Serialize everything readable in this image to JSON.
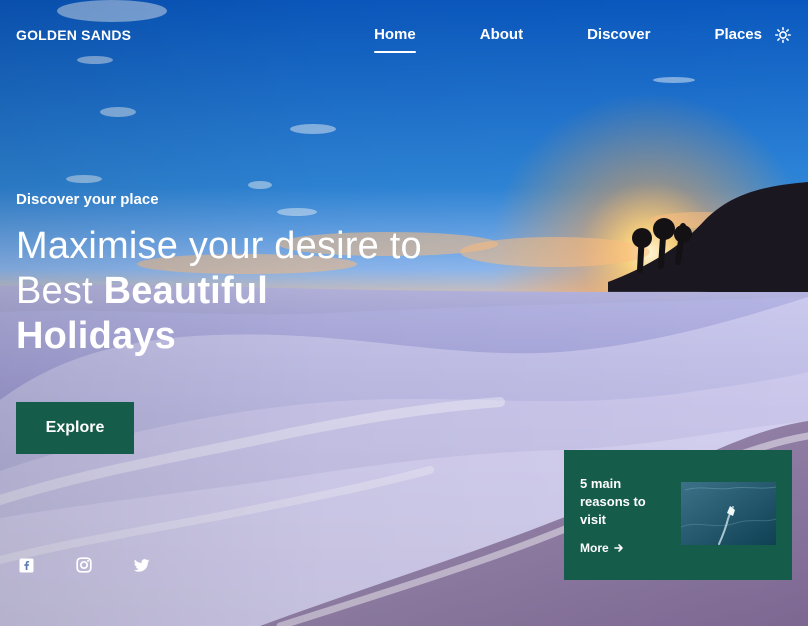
{
  "header": {
    "brand": "GOLDEN SANDS",
    "nav": [
      {
        "label": "Home",
        "active": true
      },
      {
        "label": "About",
        "active": false
      },
      {
        "label": "Discover",
        "active": false
      },
      {
        "label": "Places",
        "active": false
      }
    ],
    "theme_toggle_icon": "sun-icon"
  },
  "hero": {
    "eyebrow": "Discover your place",
    "headline_line1": "Maximise your desire to",
    "headline_line2_regular": "Best",
    "headline_line2_bold": "Beautiful",
    "headline_line3_bold": "Holidays",
    "button_label": "Explore",
    "button_color": "#165c4b",
    "background_icon": "beach-sunset-image"
  },
  "social": [
    {
      "name": "facebook",
      "icon": "facebook-icon"
    },
    {
      "name": "instagram",
      "icon": "instagram-icon"
    },
    {
      "name": "twitter",
      "icon": "twitter-icon"
    }
  ],
  "card": {
    "title": "5 main reasons to visit",
    "more_label": "More",
    "more_icon": "arrow-right-icon",
    "thumb_icon": "boat-ocean-image",
    "background_color": "#165c4b"
  },
  "colors": {
    "text": "#ffffff",
    "accent": "#165c4b",
    "sky_top": "#0d63c3",
    "sunset": "#ffb25a"
  }
}
